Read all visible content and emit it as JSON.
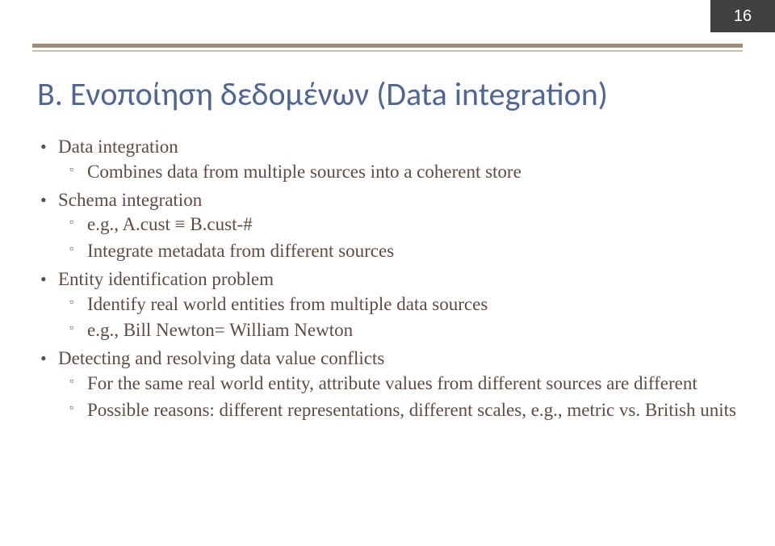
{
  "page_number": "16",
  "title": "B. Ενοποίηση δεδομένων (Data integration)",
  "bullets": {
    "b1": "Data integration",
    "b1s1": "Combines data from multiple sources into a coherent store",
    "b2": "Schema integration",
    "b2s1": "e.g., A.cust ≡ B.cust-#",
    "b2s2": "Integrate metadata from different sources",
    "b3": "Entity identification problem",
    "b3s1": "Identify real world entities from multiple data sources",
    "b3s2": "e.g., Bill Newton= William Newton",
    "b4": "Detecting and resolving data value conflicts",
    "b4s1": "For the same real world entity, attribute values from different sources are different",
    "b4s2": "Possible reasons: different representations, different scales, e.g., metric vs. British units"
  }
}
